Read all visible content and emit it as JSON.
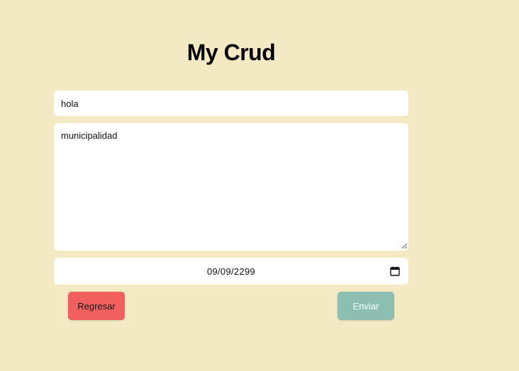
{
  "header": {
    "title": "My Crud"
  },
  "form": {
    "title_value": "hola",
    "description_value": "municipalidad",
    "date_value": "09/09/2299"
  },
  "actions": {
    "back_label": "Regresar",
    "submit_label": "Enviar"
  },
  "colors": {
    "background": "#f3eac3",
    "back_button": "#f25f5f",
    "submit_button": "#8dbfb0"
  },
  "icons": {
    "date": "calendar-icon",
    "textarea": "resize-grip-icon"
  }
}
